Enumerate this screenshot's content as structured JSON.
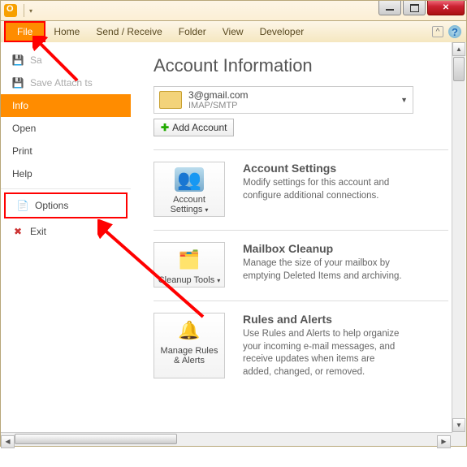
{
  "ribbon": {
    "file": "File",
    "tabs": [
      "Home",
      "Send / Receive",
      "Folder",
      "View",
      "Developer"
    ]
  },
  "sidebar": {
    "save": "Sa",
    "save_attachments": "Save Attach        ts",
    "info": "Info",
    "open": "Open",
    "print": "Print",
    "help": "Help",
    "options": "Options",
    "exit": "Exit"
  },
  "main": {
    "title": "Account Information",
    "account_email": "             3@gmail.com",
    "account_protocol": "IMAP/SMTP",
    "add_account": "Add Account",
    "sections": [
      {
        "button": "Account Settings",
        "dropdown": true,
        "heading": "Account Settings",
        "desc": "Modify settings for this account and configure additional connections."
      },
      {
        "button": "Cleanup Tools",
        "dropdown": true,
        "heading": "Mailbox Cleanup",
        "desc": "Manage the size of your mailbox by emptying Deleted Items and archiving."
      },
      {
        "button": "Manage Rules & Alerts",
        "dropdown": false,
        "heading": "Rules and Alerts",
        "desc": "Use Rules and Alerts to help organize your incoming e-mail messages, and receive updates when items are added, changed, or removed."
      }
    ]
  },
  "annotations": {
    "highlight_color": "#ff0000"
  }
}
